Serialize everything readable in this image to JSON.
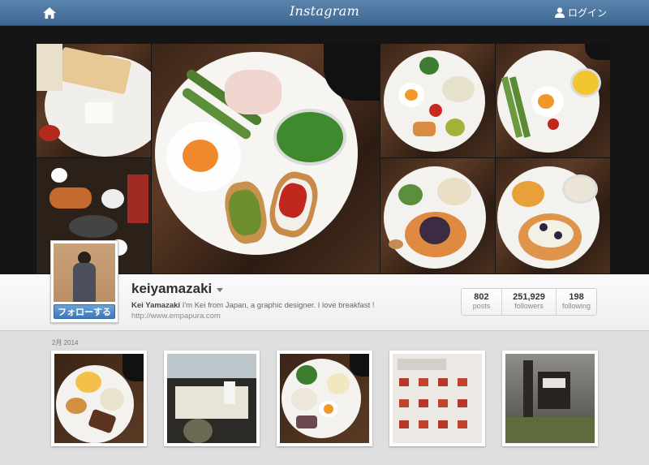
{
  "nav": {
    "logo": "Instagram",
    "login_label": "ログイン"
  },
  "profile": {
    "username": "keiyamazaki",
    "full_name": "Kei Yamazaki",
    "bio": "I'm Kei from Japan, a graphic designer. I love breakfast !",
    "website": "http://www.empapura.com",
    "follow_label": "フォローする",
    "stats": [
      {
        "num": "802",
        "label": "posts"
      },
      {
        "num": "251,929",
        "label": "followers"
      },
      {
        "num": "198",
        "label": "following"
      }
    ]
  },
  "feed": {
    "date_label": "2月 2014"
  },
  "colors": {
    "nav_blue": "#3d6691",
    "follow_blue": "#3f78b8"
  }
}
